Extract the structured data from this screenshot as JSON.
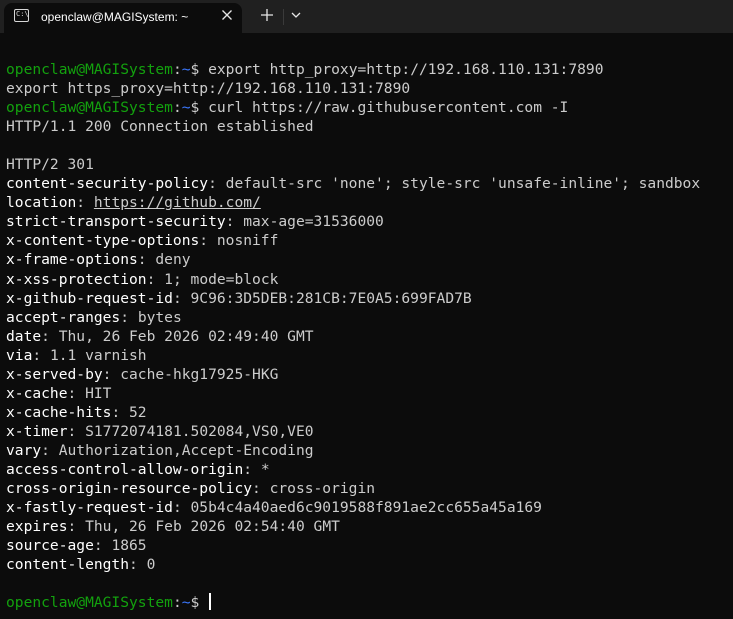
{
  "tab": {
    "icon_label": "C:\\",
    "title": "openclaw@MAGISystem: ~"
  },
  "prompt": {
    "user_host": "openclaw@MAGISystem",
    "separator": ":",
    "path": "~",
    "symbol": "$ "
  },
  "commands": [
    "export http_proxy=http://192.168.110.131:7890",
    "curl https://raw.githubusercontent.com -I"
  ],
  "continuation": "export https_proxy=http://192.168.110.131:7890",
  "output": {
    "connect_status": "HTTP/1.1 200 Connection established",
    "status": "HTTP/2 301",
    "headers": [
      {
        "key": "content-security-policy",
        "value": "default-src 'none'; style-src 'unsafe-inline'; sandbox"
      },
      {
        "key": "location",
        "value": "https://github.com/"
      },
      {
        "key": "strict-transport-security",
        "value": "max-age=31536000"
      },
      {
        "key": "x-content-type-options",
        "value": "nosniff"
      },
      {
        "key": "x-frame-options",
        "value": "deny"
      },
      {
        "key": "x-xss-protection",
        "value": "1; mode=block"
      },
      {
        "key": "x-github-request-id",
        "value": "9C96:3D5DEB:281CB:7E0A5:699FAD7B"
      },
      {
        "key": "accept-ranges",
        "value": "bytes"
      },
      {
        "key": "date",
        "value": "Thu, 26 Feb 2026 02:49:40 GMT"
      },
      {
        "key": "via",
        "value": "1.1 varnish"
      },
      {
        "key": "x-served-by",
        "value": "cache-hkg17925-HKG"
      },
      {
        "key": "x-cache",
        "value": "HIT"
      },
      {
        "key": "x-cache-hits",
        "value": "52"
      },
      {
        "key": "x-timer",
        "value": "S1772074181.502084,VS0,VE0"
      },
      {
        "key": "vary",
        "value": "Authorization,Accept-Encoding"
      },
      {
        "key": "access-control-allow-origin",
        "value": "*"
      },
      {
        "key": "cross-origin-resource-policy",
        "value": "cross-origin"
      },
      {
        "key": "x-fastly-request-id",
        "value": "05b4c4a40aed6c9019588f891ae2cc655a45a169"
      },
      {
        "key": "expires",
        "value": "Thu, 26 Feb 2026 02:54:40 GMT"
      },
      {
        "key": "source-age",
        "value": "1865"
      },
      {
        "key": "content-length",
        "value": "0"
      }
    ],
    "header_separator": ": "
  },
  "colors": {
    "background": "#0c0c0c",
    "titlebar": "#202020",
    "user_host": "#13a10e",
    "path": "#3b78ff",
    "text": "#cccccc",
    "header_key": "#ffffff"
  }
}
